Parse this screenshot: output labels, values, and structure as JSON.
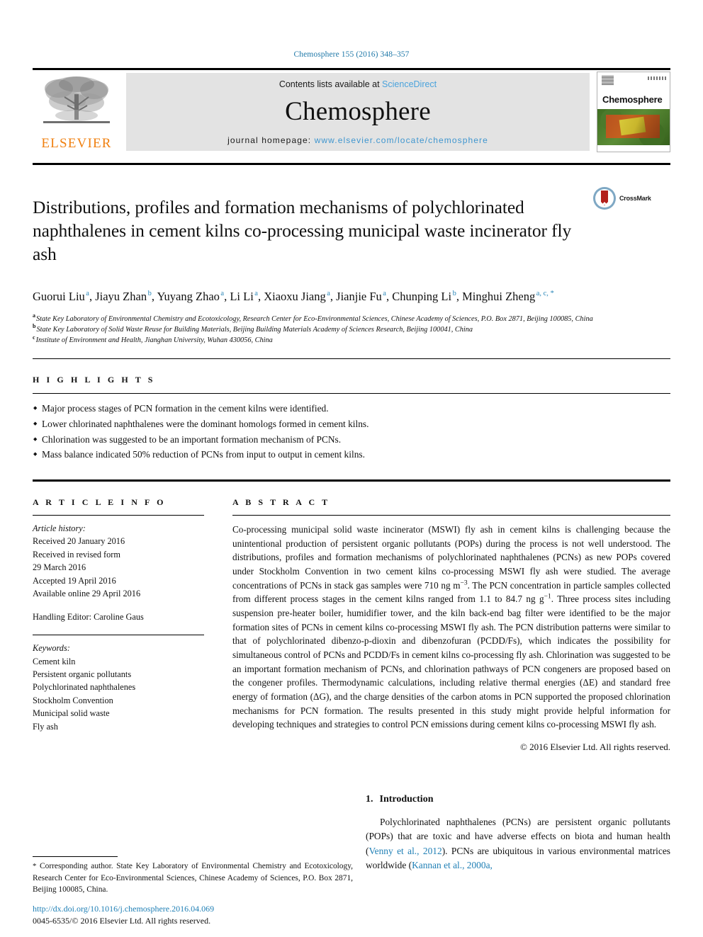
{
  "running_head": "Chemosphere 155 (2016) 348–357",
  "masthead": {
    "publisher_name": "ELSEVIER",
    "contents_prefix": "Contents lists available at ",
    "contents_link": "ScienceDirect",
    "journal_name": "Chemosphere",
    "homepage_prefix": "journal homepage: ",
    "homepage_url": "www.elsevier.com/locate/chemosphere",
    "cover_title": "Chemosphere",
    "link_color": "#4aa3dc",
    "banner_bg": "#e3e3e3",
    "elsevier_orange": "#f08010"
  },
  "article": {
    "title": "Distributions, profiles and formation mechanisms of polychlorinated naphthalenes in cement kilns co-processing municipal waste incinerator fly ash",
    "crossmark_label": "CrossMark",
    "authors": [
      {
        "name": "Guorui Liu",
        "marks": "a",
        "sep": ", "
      },
      {
        "name": "Jiayu Zhan",
        "marks": "b",
        "sep": ", "
      },
      {
        "name": "Yuyang Zhao",
        "marks": "a",
        "sep": ", "
      },
      {
        "name": "Li Li",
        "marks": "a",
        "sep": ", "
      },
      {
        "name": "Xiaoxu Jiang",
        "marks": "a",
        "sep": ", "
      },
      {
        "name": "Jianjie Fu",
        "marks": "a",
        "sep": ", "
      },
      {
        "name": "Chunping Li",
        "marks": "b",
        "sep": ", "
      },
      {
        "name": "Minghui Zheng",
        "marks": "a, c, *",
        "sep": ""
      }
    ],
    "affiliations": [
      {
        "mark": "a",
        "text": "State Key Laboratory of Environmental Chemistry and Ecotoxicology, Research Center for Eco-Environmental Sciences, Chinese Academy of Sciences, P.O. Box 2871, Beijing 100085, China"
      },
      {
        "mark": "b",
        "text": "State Key Laboratory of Solid Waste Reuse for Building Materials, Beijing Building Materials Academy of Sciences Research, Beijing 100041, China"
      },
      {
        "mark": "c",
        "text": "Institute of Environment and Health, Jianghan University, Wuhan 430056, China"
      }
    ]
  },
  "highlights": {
    "label": "H I G H L I G H T S",
    "items": [
      "Major process stages of PCN formation in the cement kilns were identified.",
      "Lower chlorinated naphthalenes were the dominant homologs formed in cement kilns.",
      "Chlorination was suggested to be an important formation mechanism of PCNs.",
      "Mass balance indicated 50% reduction of PCNs from input to output in cement kilns."
    ]
  },
  "article_info": {
    "label": "A R T I C L E  I N F O",
    "history_title": "Article history:",
    "history": [
      "Received 20 January 2016",
      "Received in revised form",
      "29 March 2016",
      "Accepted 19 April 2016",
      "Available online 29 April 2016"
    ],
    "handling_editor": "Handling Editor: Caroline Gaus",
    "keywords_title": "Keywords:",
    "keywords": [
      "Cement kiln",
      "Persistent organic pollutants",
      "Polychlorinated naphthalenes",
      "Stockholm Convention",
      "Municipal solid waste",
      "Fly ash"
    ]
  },
  "abstract": {
    "label": "A B S T R A C T",
    "part1": "Co-processing municipal solid waste incinerator (MSWI) fly ash in cement kilns is challenging because the unintentional production of persistent organic pollutants (POPs) during the process is not well understood. The distributions, profiles and formation mechanisms of polychlorinated naphthalenes (PCNs) as new POPs covered under Stockholm Convention in two cement kilns co-processing MSWI fly ash were studied. The average concentrations of PCNs in stack gas samples were 710 ng m",
    "sup1": "−3",
    "part2": ". The PCN concentration in particle samples collected from different process stages in the cement kilns ranged from 1.1 to 84.7 ng g",
    "sup2": "−1",
    "part3": ". Three process sites including suspension pre-heater boiler, humidifier tower, and the kiln back-end bag filter were identified to be the major formation sites of PCNs in cement kilns co-processing MSWI fly ash. The PCN distribution patterns were similar to that of polychlorinated dibenzo-p-dioxin and dibenzofuran (PCDD/Fs), which indicates the possibility for simultaneous control of PCNs and PCDD/Fs in cement kilns co-processing fly ash. Chlorination was suggested to be an important formation mechanism of PCNs, and chlorination pathways of PCN congeners are proposed based on the congener profiles. Thermodynamic calculations, including relative thermal energies (ΔE) and standard free energy of formation (ΔG), and the charge densities of the carbon atoms in PCN supported the proposed chlorination mechanisms for PCN formation. The results presented in this study might provide helpful information for developing techniques and strategies to control PCN emissions during cement kilns co-processing MSWI fly ash.",
    "copyright": "© 2016 Elsevier Ltd. All rights reserved."
  },
  "introduction": {
    "number": "1.",
    "heading": "Introduction",
    "para_a": "Polychlorinated naphthalenes (PCNs) are persistent organic pollutants (POPs) that are toxic and have adverse effects on biota and human health (",
    "cite1": "Venny et al., 2012",
    "para_b": "). PCNs are ubiquitous in various environmental matrices worldwide (",
    "cite2": "Kannan et al., 2000a,"
  },
  "footnote": {
    "star": "*",
    "text": " Corresponding author. State Key Laboratory of Environmental Chemistry and Ecotoxicology, Research Center for Eco-Environmental Sciences, Chinese Academy of Sciences, P.O. Box 2871, Beijing 100085, China."
  },
  "doi": {
    "url": "http://dx.doi.org/10.1016/j.chemosphere.2016.04.069",
    "issn_line": "0045-6535/© 2016 Elsevier Ltd. All rights reserved."
  }
}
